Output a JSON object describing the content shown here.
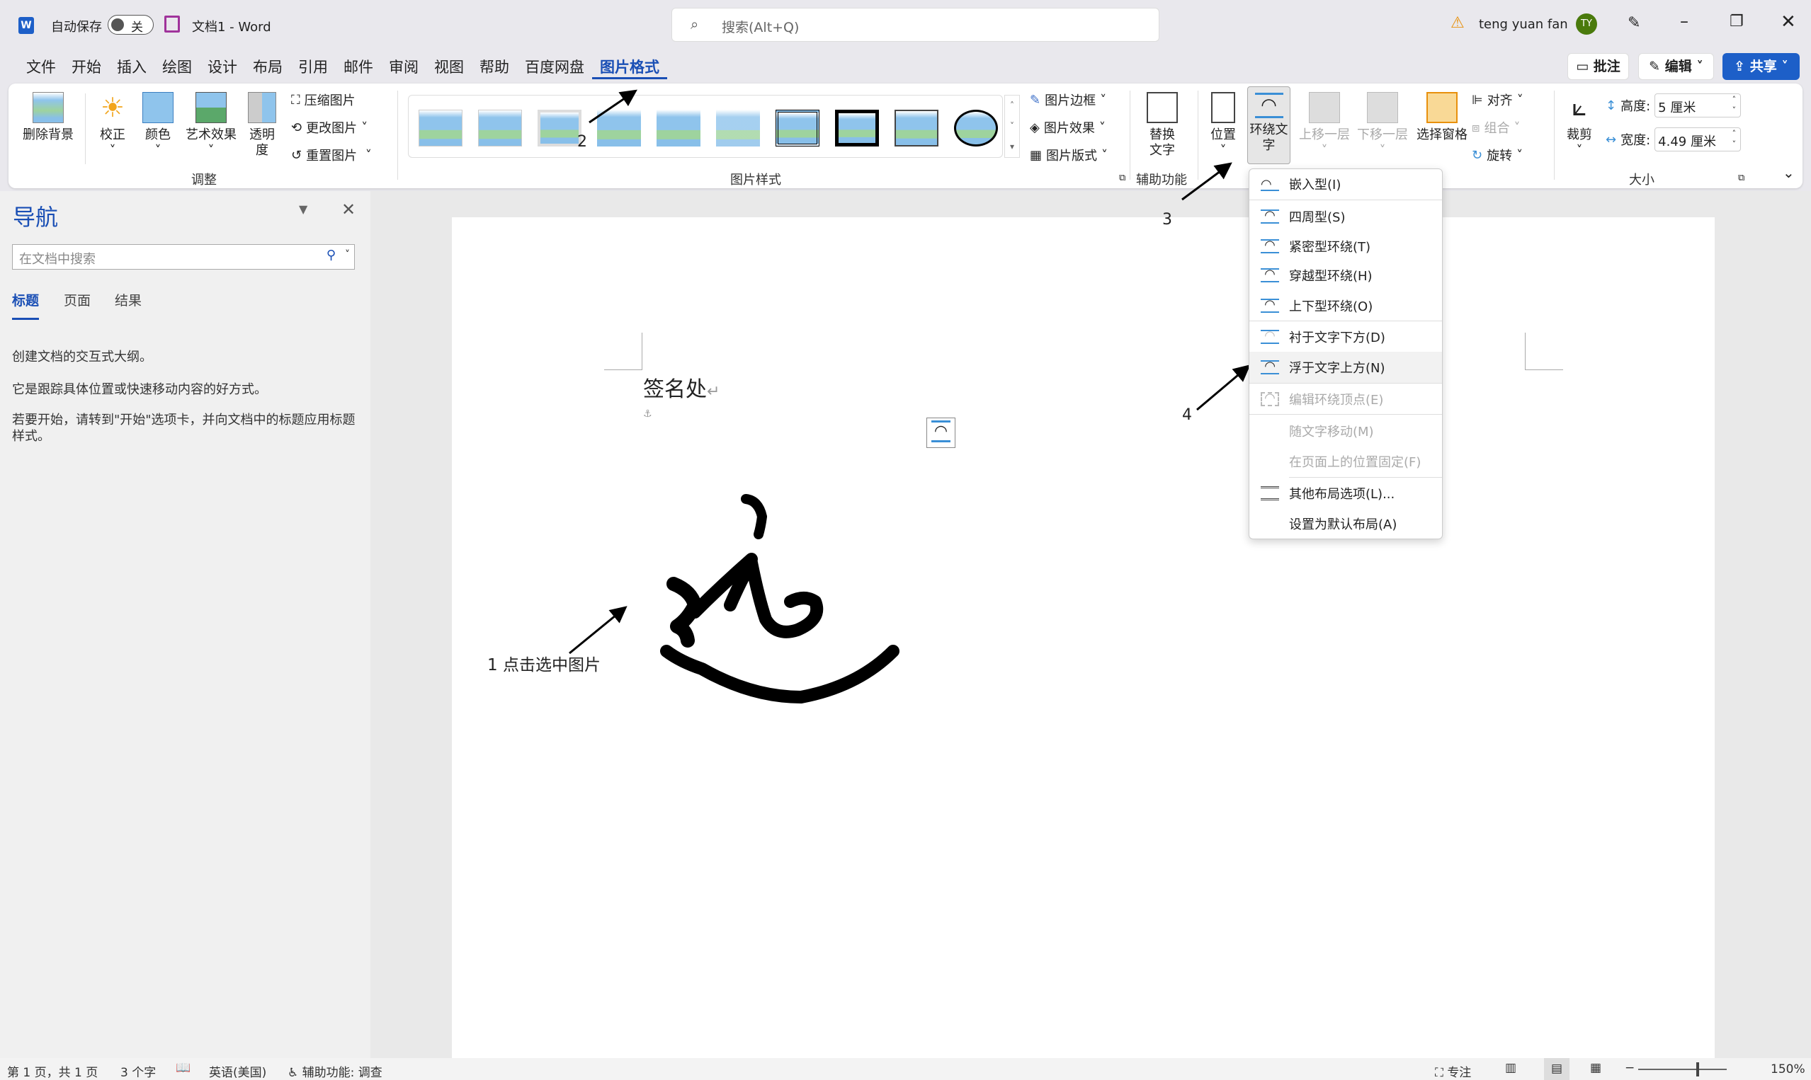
{
  "titlebar": {
    "autosave_label": "自动保存",
    "autosave_state": "关",
    "doc_title": "文档1  -  Word",
    "search_placeholder": "搜索(Alt+Q)",
    "user_name": "teng yuan fan",
    "avatar_initials": "TY"
  },
  "menu_tabs": [
    "文件",
    "开始",
    "插入",
    "绘图",
    "设计",
    "布局",
    "引用",
    "邮件",
    "审阅",
    "视图",
    "帮助",
    "百度网盘",
    "图片格式"
  ],
  "active_tab": "图片格式",
  "header_buttons": {
    "comment": "批注",
    "edit": "编辑",
    "share": "共享"
  },
  "ribbon": {
    "adjust": {
      "remove_bg": "删除背景",
      "corrections": "校正",
      "color": "颜色",
      "artistic": "艺术效果",
      "transparency": "透明度",
      "compress": "压缩图片",
      "change": "更改图片",
      "reset": "重置图片",
      "label": "调整"
    },
    "styles": {
      "border": "图片边框",
      "effects": "图片效果",
      "layout": "图片版式",
      "label": "图片样式"
    },
    "accessibility": {
      "alt_text": "替换文字",
      "label": "辅助功能"
    },
    "arrange": {
      "position": "位置",
      "wrap_text": "环绕文字",
      "bring_forward": "上移一层",
      "send_backward": "下移一层",
      "selection_pane": "选择窗格",
      "align": "对齐",
      "group": "组合",
      "rotate": "旋转"
    },
    "size": {
      "crop": "裁剪",
      "height_label": "高度:",
      "height_value": "5 厘米",
      "width_label": "宽度:",
      "width_value": "4.49 厘米",
      "label": "大小"
    }
  },
  "nav": {
    "title": "导航",
    "search_placeholder": "在文档中搜索",
    "tabs": [
      "标题",
      "页面",
      "结果"
    ],
    "lines": [
      "创建文档的交互式大纲。",
      "它是跟踪具体位置或快速移动内容的好方式。",
      "若要开始，请转到\"开始\"选项卡，并向文档中的标题应用标题样式。"
    ]
  },
  "document": {
    "heading": "签名处",
    "annotations": {
      "a1": "1 点击选中图片",
      "a2": "2",
      "a3": "3",
      "a4": "4"
    }
  },
  "wrap_menu": [
    {
      "label": "嵌入型(I)",
      "enabled": true
    },
    {
      "label": "四周型(S)",
      "enabled": true
    },
    {
      "label": "紧密型环绕(T)",
      "enabled": true
    },
    {
      "label": "穿越型环绕(H)",
      "enabled": true
    },
    {
      "label": "上下型环绕(O)",
      "enabled": true
    },
    {
      "label": "衬于文字下方(D)",
      "enabled": true
    },
    {
      "label": "浮于文字上方(N)",
      "enabled": true,
      "hovered": true
    },
    {
      "label": "编辑环绕顶点(E)",
      "enabled": false
    },
    {
      "label": "随文字移动(M)",
      "enabled": false
    },
    {
      "label": "在页面上的位置固定(F)",
      "enabled": false
    },
    {
      "label": "其他布局选项(L)...",
      "enabled": true
    },
    {
      "label": "设置为默认布局(A)",
      "enabled": true
    }
  ],
  "status": {
    "page": "第 1 页，共 1 页",
    "words": "3 个字",
    "language": "英语(美国)",
    "accessibility": "辅助功能: 调查",
    "focus": "专注",
    "zoom": "150%"
  },
  "colors": {
    "accent": "#1a4fb5",
    "share_bg": "#1d5fc8",
    "avatar_bg": "#4a7a0c"
  }
}
